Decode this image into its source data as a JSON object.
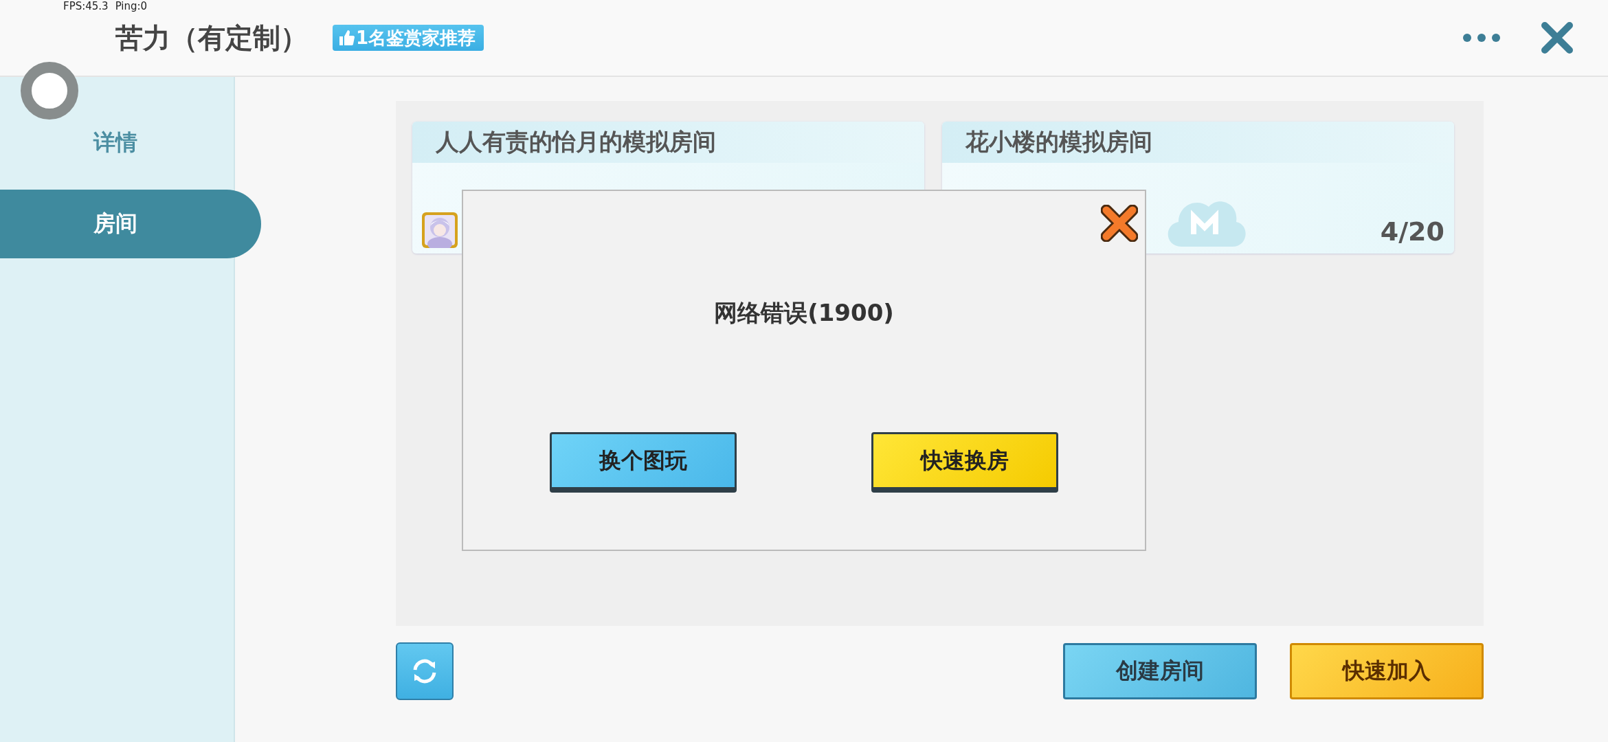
{
  "status_overlay": {
    "fps": "FPS:45.3",
    "ping": "Ping:0"
  },
  "header": {
    "title": "苦力（有定制）",
    "badge": "1名鉴赏家推荐"
  },
  "sidebar": {
    "items": [
      {
        "label": "详情",
        "selected": false
      },
      {
        "label": "房间",
        "selected": true
      }
    ]
  },
  "rooms": [
    {
      "name": "人人有责的怡月的模拟房间"
    },
    {
      "name": "花小楼的模拟房间",
      "count": "4/20"
    }
  ],
  "dialog": {
    "message": "网络错误(1900)",
    "buttons": [
      {
        "label": "换个图玩",
        "kind": "blue"
      },
      {
        "label": "快速换房",
        "kind": "yellow"
      }
    ]
  },
  "footer": {
    "buttons": [
      {
        "label": "创建房间",
        "kind": "blue"
      },
      {
        "label": "快速加入",
        "kind": "yellow"
      }
    ]
  }
}
